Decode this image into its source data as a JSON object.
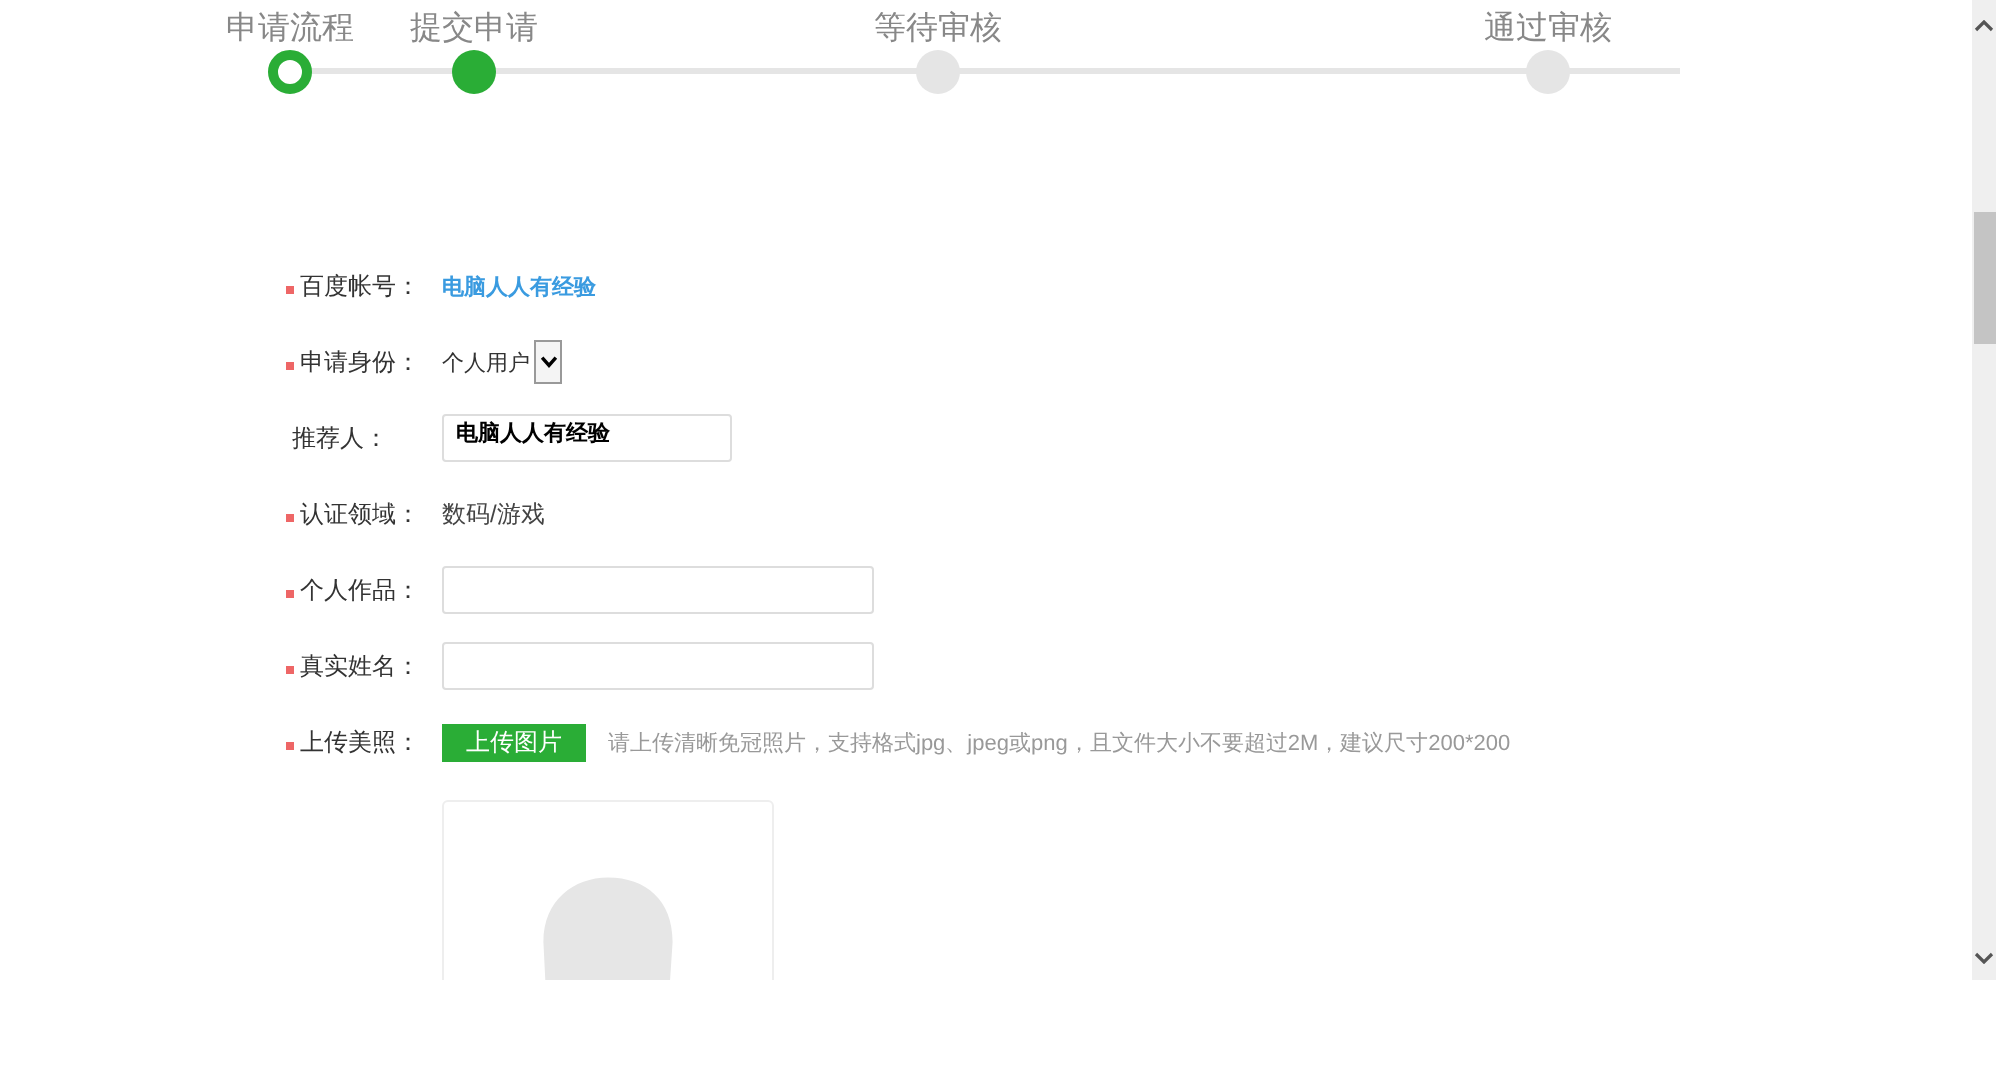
{
  "steps": [
    {
      "label": "申请流程",
      "selected": true,
      "done": false
    },
    {
      "label": "提交申请",
      "selected": false,
      "done": true
    },
    {
      "label": "等待审核",
      "selected": false,
      "done": false
    },
    {
      "label": "通过审核",
      "selected": false,
      "done": false
    }
  ],
  "form": {
    "fields": [
      {
        "kind": "link",
        "label": "百度帐号：",
        "required": true,
        "value": "电脑人人有经验"
      },
      {
        "kind": "select",
        "label": "申请身份：",
        "required": true,
        "value": "个人用户"
      },
      {
        "kind": "input",
        "label": "推荐人：",
        "required": false,
        "value": "电脑人人有经验"
      },
      {
        "kind": "text",
        "label": "认证领域：",
        "required": true,
        "value": "数码/游戏"
      },
      {
        "kind": "wide_input",
        "label": "个人作品：",
        "required": true
      },
      {
        "kind": "wide_input",
        "label": "真实姓名：",
        "required": true
      },
      {
        "kind": "upload",
        "label": "上传美照：",
        "required": true,
        "button": "上传图片",
        "hint": "请上传清晰免冠照片，支持格式jpg、jpeg或png，且文件大小不要超过2M，建议尺寸200*200"
      }
    ]
  }
}
